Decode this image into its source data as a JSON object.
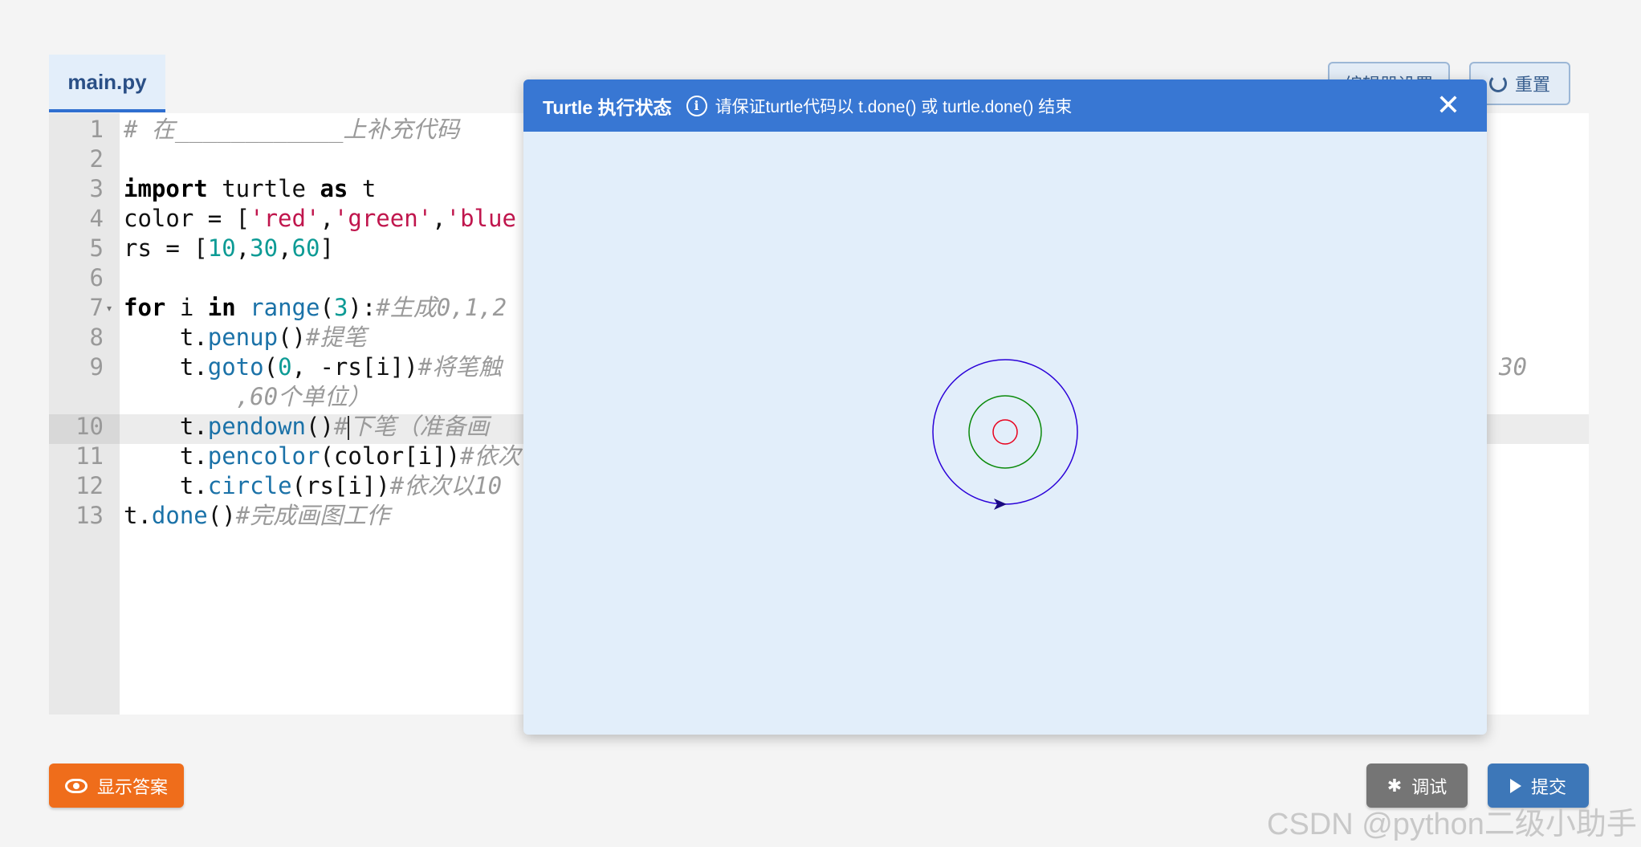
{
  "tab": {
    "label": "main.py"
  },
  "toolbar": {
    "settings_label": "编辑器设置",
    "reset_label": "重置"
  },
  "editor": {
    "line_numbers": [
      "1",
      "2",
      "3",
      "4",
      "5",
      "6",
      "7",
      "8",
      "9",
      "",
      "10",
      "11",
      "12",
      "13"
    ],
    "code": {
      "l1_comment": "# 在____________上补充代码",
      "l3_import": "import",
      "l3_mid": " turtle ",
      "l3_as": "as",
      "l3_end": " t",
      "l4_a": "color = [",
      "l4_s1": "'red'",
      "l4_c1": ",",
      "l4_s2": "'green'",
      "l4_c2": ",",
      "l4_s3": "'blue",
      "l5_a": "rs = [",
      "l5_n1": "10",
      "l5_c1": ",",
      "l5_n2": "30",
      "l5_c2": ",",
      "l5_n3": "60",
      "l5_b": "]",
      "l7_for": "for",
      "l7_i": " i ",
      "l7_in": "in",
      "l7_sp": " ",
      "l7_range": "range",
      "l7_p1": "(",
      "l7_n": "3",
      "l7_p2": "):",
      "l7_cm": "#生成0,1,2",
      "l8_t": "    t.",
      "l8_fn": "penup",
      "l8_p": "()",
      "l8_cm": "#提笔",
      "l9_t": "    t.",
      "l9_fn": "goto",
      "l9_p1": "(",
      "l9_n": "0",
      "l9_rest": ", -rs[i])",
      "l9_cm": "#将笔触",
      "l9_tail": "30",
      "l9w_cm": "        ,60个单位）",
      "l10_t": "    t.",
      "l10_fn": "pendown",
      "l10_p": "()",
      "l10_cm1": "#",
      "l10_cm2": "下笔（准备画",
      "l11_t": "    t.",
      "l11_fn": "pencolor",
      "l11_p": "(color[i])",
      "l11_cm": "#依次",
      "l12_t": "    t.",
      "l12_fn": "circle",
      "l12_p": "(rs[i])",
      "l12_cm": "#依次以10",
      "l13_t": "t.",
      "l13_fn": "done",
      "l13_p": "()",
      "l13_cm": "#完成画图工作"
    }
  },
  "modal": {
    "title": "Turtle 执行状态",
    "hint": "请保证turtle代码以 t.done() 或 turtle.done() 结束",
    "info_icon": "info-icon",
    "close_icon": "close-icon",
    "close_glyph": "✕"
  },
  "drawing": {
    "circles": [
      {
        "color": "#e8001c",
        "radius": 10
      },
      {
        "color": "#0a8a0a",
        "radius": 30
      },
      {
        "color": "#2a00d8",
        "radius": 60
      }
    ],
    "turtle_color": "#1a0a80"
  },
  "buttons": {
    "show_answer": "显示答案",
    "debug": "调试",
    "submit": "提交"
  },
  "watermark": "CSDN @python二级小助手"
}
